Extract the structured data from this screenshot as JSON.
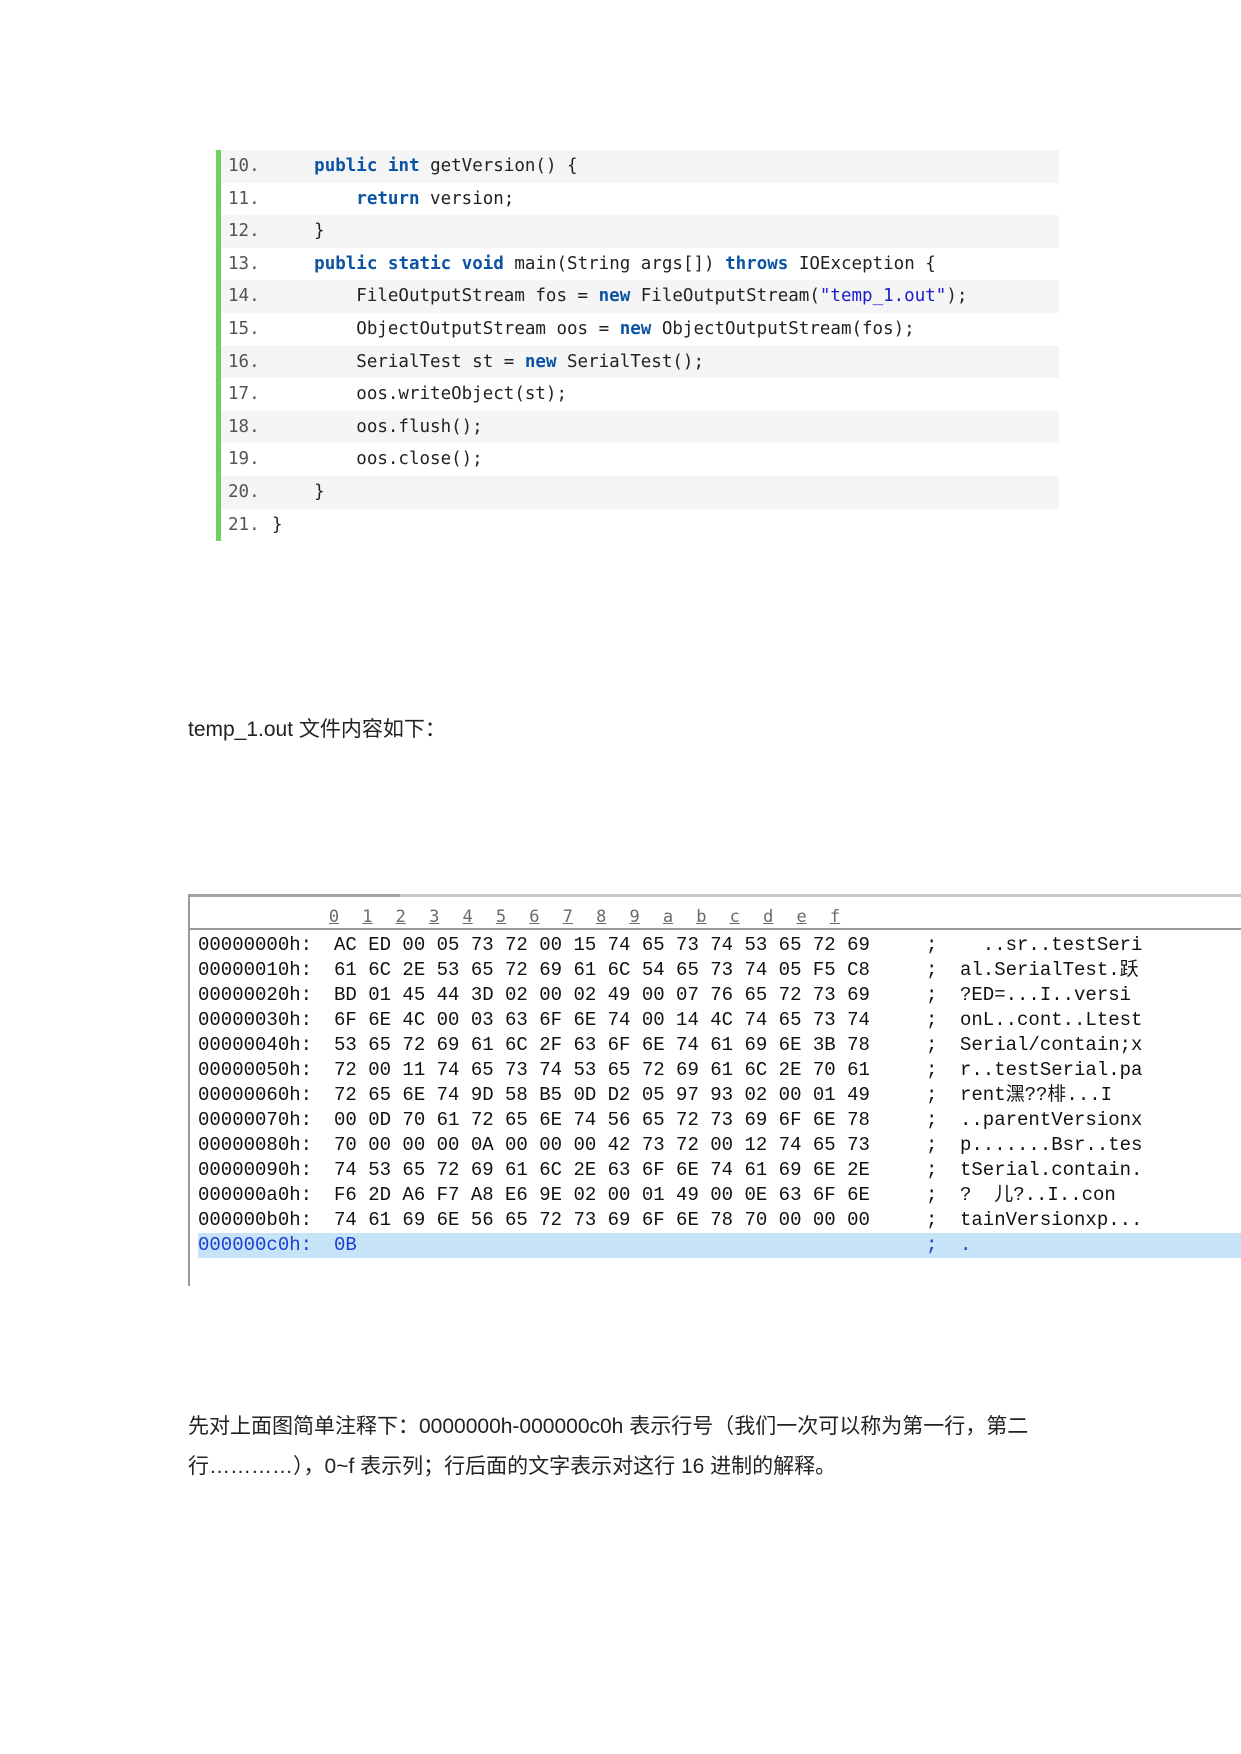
{
  "code_lines": [
    {
      "ln": "10.",
      "alt": true,
      "parts": [
        [
          "",
          "    "
        ],
        [
          "kw",
          "public"
        ],
        [
          "",
          " "
        ],
        [
          "kw",
          "int"
        ],
        [
          "",
          " getVersion() {"
        ]
      ]
    },
    {
      "ln": "11.",
      "alt": false,
      "parts": [
        [
          "",
          "        "
        ],
        [
          "kw",
          "return"
        ],
        [
          "",
          " version;"
        ]
      ]
    },
    {
      "ln": "12.",
      "alt": true,
      "parts": [
        [
          "",
          "    }"
        ]
      ]
    },
    {
      "ln": "13.",
      "alt": false,
      "parts": [
        [
          "",
          "    "
        ],
        [
          "kw",
          "public"
        ],
        [
          "",
          " "
        ],
        [
          "kw",
          "static"
        ],
        [
          "",
          " "
        ],
        [
          "kw",
          "void"
        ],
        [
          "",
          " main(String args[]) "
        ],
        [
          "kw",
          "throws"
        ],
        [
          "",
          " IOException {"
        ]
      ]
    },
    {
      "ln": "14.",
      "alt": true,
      "parts": [
        [
          "",
          "        FileOutputStream fos = "
        ],
        [
          "kw",
          "new"
        ],
        [
          "",
          " FileOutputStream("
        ],
        [
          "str",
          "\"temp_1.out\""
        ],
        [
          "",
          ");"
        ]
      ]
    },
    {
      "ln": "15.",
      "alt": false,
      "parts": [
        [
          "",
          "        ObjectOutputStream oos = "
        ],
        [
          "kw",
          "new"
        ],
        [
          "",
          " ObjectOutputStream(fos);"
        ]
      ]
    },
    {
      "ln": "16.",
      "alt": true,
      "parts": [
        [
          "",
          "        SerialTest st = "
        ],
        [
          "kw",
          "new"
        ],
        [
          "",
          " SerialTest();"
        ]
      ]
    },
    {
      "ln": "17.",
      "alt": false,
      "parts": [
        [
          "",
          "        oos.writeObject(st);"
        ]
      ]
    },
    {
      "ln": "18.",
      "alt": true,
      "parts": [
        [
          "",
          "        oos.flush();"
        ]
      ]
    },
    {
      "ln": "19.",
      "alt": false,
      "parts": [
        [
          "",
          "        oos.close();"
        ]
      ]
    },
    {
      "ln": "20.",
      "alt": true,
      "parts": [
        [
          "",
          "    }"
        ]
      ]
    },
    {
      "ln": "21.",
      "alt": false,
      "parts": [
        [
          "",
          "}"
        ]
      ]
    }
  ],
  "caption1": "temp_1.out 文件内容如下：",
  "hex": {
    "columns": [
      "0",
      "1",
      "2",
      "3",
      "4",
      "5",
      "6",
      "7",
      "8",
      "9",
      "a",
      "b",
      "c",
      "d",
      "e",
      "f"
    ],
    "rows": [
      {
        "offset": "00000000h:",
        "bytes": "AC ED 00 05 73 72 00 15 74 65 73 74 53 65 72 69",
        "ascii": "  ..sr..testSeri",
        "selected": false
      },
      {
        "offset": "00000010h:",
        "bytes": "61 6C 2E 53 65 72 69 61 6C 54 65 73 74 05 F5 C8",
        "ascii": "al.SerialTest.跃",
        "selected": false
      },
      {
        "offset": "00000020h:",
        "bytes": "BD 01 45 44 3D 02 00 02 49 00 07 76 65 72 73 69",
        "ascii": "?ED=...I..versi",
        "selected": false
      },
      {
        "offset": "00000030h:",
        "bytes": "6F 6E 4C 00 03 63 6F 6E 74 00 14 4C 74 65 73 74",
        "ascii": "onL..cont..Ltest",
        "selected": false
      },
      {
        "offset": "00000040h:",
        "bytes": "53 65 72 69 61 6C 2F 63 6F 6E 74 61 69 6E 3B 78",
        "ascii": "Serial/contain;x",
        "selected": false
      },
      {
        "offset": "00000050h:",
        "bytes": "72 00 11 74 65 73 74 53 65 72 69 61 6C 2E 70 61",
        "ascii": "r..testSerial.pa",
        "selected": false
      },
      {
        "offset": "00000060h:",
        "bytes": "72 65 6E 74 9D 58 B5 0D D2 05 97 93 02 00 01 49",
        "ascii": "rent潶??棑...I",
        "selected": false
      },
      {
        "offset": "00000070h:",
        "bytes": "00 0D 70 61 72 65 6E 74 56 65 72 73 69 6F 6E 78",
        "ascii": "..parentVersionx",
        "selected": false
      },
      {
        "offset": "00000080h:",
        "bytes": "70 00 00 00 0A 00 00 00 42 73 72 00 12 74 65 73",
        "ascii": "p.......Bsr..tes",
        "selected": false
      },
      {
        "offset": "00000090h:",
        "bytes": "74 53 65 72 69 61 6C 2E 63 6F 6E 74 61 69 6E 2E",
        "ascii": "tSerial.contain.",
        "selected": false
      },
      {
        "offset": "000000a0h:",
        "bytes": "F6 2D A6 F7 A8 E6 9E 02 00 01 49 00 0E 63 6F 6E",
        "ascii": "?  儿?..I..con",
        "selected": false
      },
      {
        "offset": "000000b0h:",
        "bytes": "74 61 69 6E 56 65 72 73 69 6F 6E 78 70 00 00 00",
        "ascii": "tainVersionxp...",
        "selected": false
      },
      {
        "offset": "000000c0h:",
        "bytes": "0B",
        "ascii": ".",
        "selected": true
      }
    ],
    "separator": ";"
  },
  "caption2_line1": "先对上面图简单注释下：0000000h-000000c0h 表示行号（我们一次可以称为第一行，第二",
  "caption2_line2": "行…………），0~f 表示列；行后面的文字表示对这行 16 进制的解释。"
}
